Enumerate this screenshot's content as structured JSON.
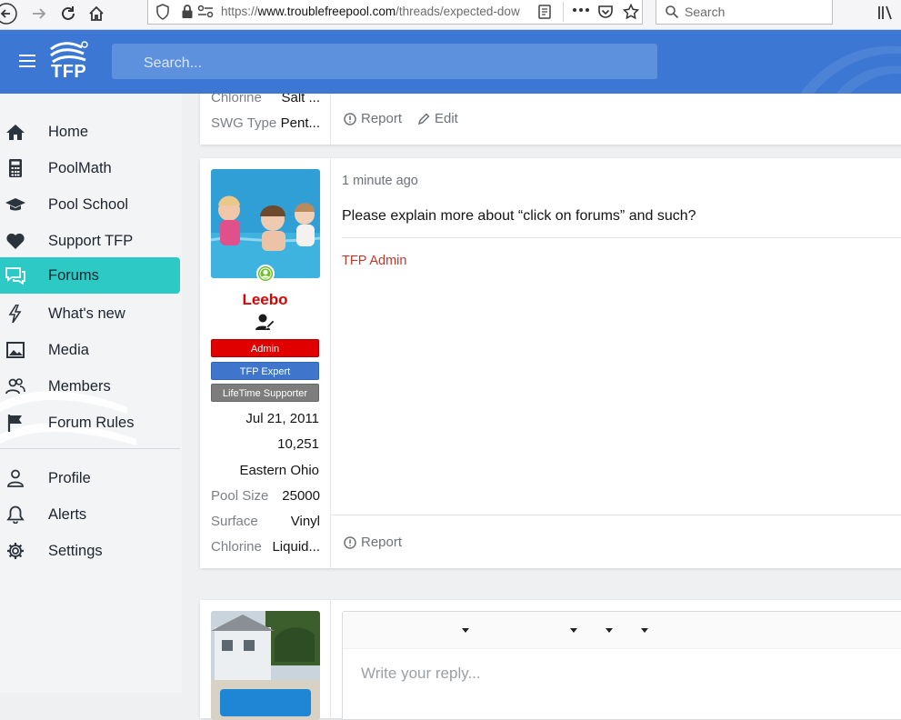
{
  "browser": {
    "url": "https://www.troublefreepool.com/threads/expected-dow",
    "url_host": "www.troublefreepool.com",
    "url_path": "/threads/expected-dow",
    "url_scheme": "https://",
    "search_placeholder": "Search"
  },
  "site": {
    "logo_text": "TFP",
    "search_placeholder": "Search..."
  },
  "sidebar": {
    "items": [
      {
        "label": "Home",
        "icon": "home-icon"
      },
      {
        "label": "PoolMath",
        "icon": "calculator-icon"
      },
      {
        "label": "Pool School",
        "icon": "graduation-cap-icon"
      },
      {
        "label": "Support TFP",
        "icon": "heart-icon"
      },
      {
        "label": "Forums",
        "icon": "comments-icon",
        "active": true
      },
      {
        "label": "What's new",
        "icon": "bolt-icon"
      },
      {
        "label": "Media",
        "icon": "image-icon"
      },
      {
        "label": "Members",
        "icon": "users-icon"
      },
      {
        "label": "Forum Rules",
        "icon": "flag-icon"
      }
    ],
    "account_items": [
      {
        "label": "Profile",
        "icon": "user-icon"
      },
      {
        "label": "Alerts",
        "icon": "bell-icon"
      },
      {
        "label": "Settings",
        "icon": "gear-icon"
      }
    ]
  },
  "post_prev": {
    "info": [
      {
        "key": "Chlorine",
        "value": "Salt ..."
      },
      {
        "key": "SWG Type",
        "value": "Pent..."
      }
    ],
    "report_label": "Report",
    "edit_label": "Edit"
  },
  "post": {
    "time": "1 minute ago",
    "body": "Please explain more about “click on forums” and such?",
    "signature": "TFP Admin",
    "username": "Leebo",
    "badges": [
      {
        "label": "Admin",
        "color": "#e00000"
      },
      {
        "label": "TFP Expert",
        "color": "#3f76cc"
      },
      {
        "label": "LifeTime Supporter",
        "color": "#7d7d7d"
      }
    ],
    "joined": "Jul 21, 2011",
    "messages": "10,251",
    "location": "Eastern Ohio",
    "info": [
      {
        "key": "Pool Size",
        "value": "25000"
      },
      {
        "key": "Surface",
        "value": "Vinyl"
      },
      {
        "key": "Chlorine",
        "value": "Liquid..."
      }
    ],
    "report_label": "Report"
  },
  "reply": {
    "placeholder": "Write your reply..."
  },
  "colors": {
    "header_blue": "#3c78d3",
    "active_teal": "#2dc9c4",
    "username_red": "#e00000",
    "signature_red": "#c0392b"
  }
}
